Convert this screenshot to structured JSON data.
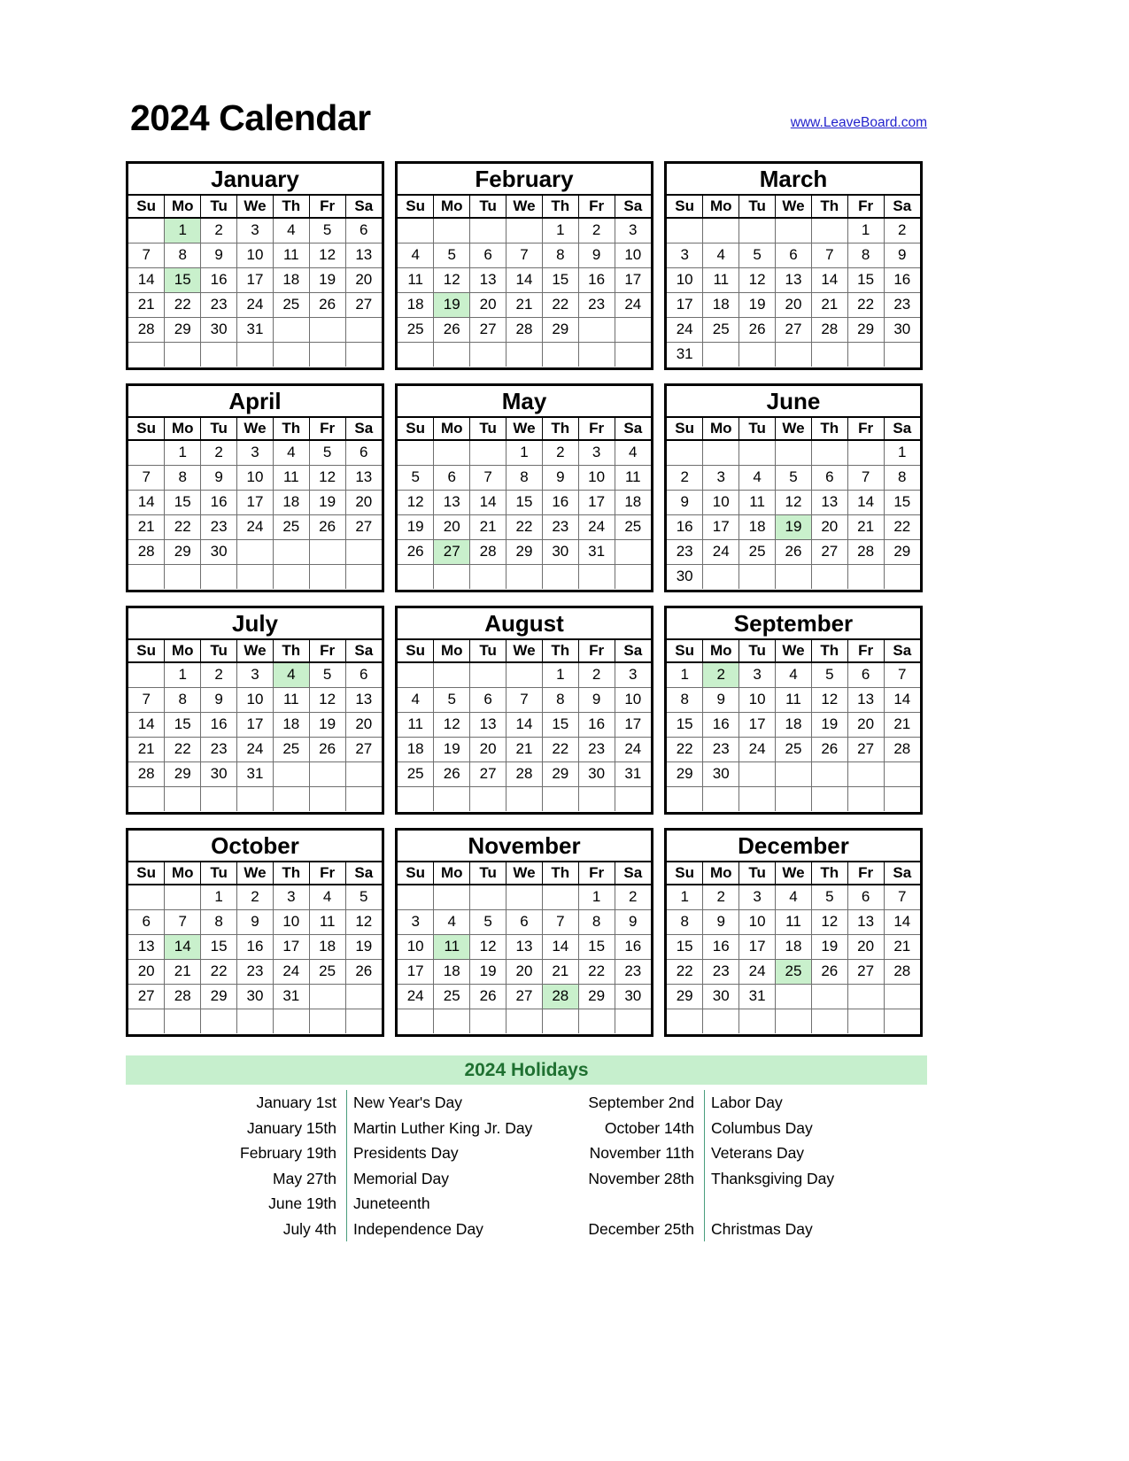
{
  "header": {
    "title": "2024 Calendar",
    "url": "www.LeaveBoard.com",
    "url_color": "#2222cc"
  },
  "weekdays": [
    "Su",
    "Mo",
    "Tu",
    "We",
    "Th",
    "Fr",
    "Sa"
  ],
  "highlight_color": "#c9f0cc",
  "months": [
    {
      "name": "January",
      "weeks": [
        [
          "",
          "1",
          "2",
          "3",
          "4",
          "5",
          "6"
        ],
        [
          "7",
          "8",
          "9",
          "10",
          "11",
          "12",
          "13"
        ],
        [
          "14",
          "15",
          "16",
          "17",
          "18",
          "19",
          "20"
        ],
        [
          "21",
          "22",
          "23",
          "24",
          "25",
          "26",
          "27"
        ],
        [
          "28",
          "29",
          "30",
          "31",
          "",
          "",
          ""
        ],
        [
          "",
          "",
          "",
          "",
          "",
          "",
          ""
        ]
      ],
      "highlights": [
        "1",
        "15"
      ]
    },
    {
      "name": "February",
      "weeks": [
        [
          "",
          "",
          "",
          "",
          "1",
          "2",
          "3"
        ],
        [
          "4",
          "5",
          "6",
          "7",
          "8",
          "9",
          "10"
        ],
        [
          "11",
          "12",
          "13",
          "14",
          "15",
          "16",
          "17"
        ],
        [
          "18",
          "19",
          "20",
          "21",
          "22",
          "23",
          "24"
        ],
        [
          "25",
          "26",
          "27",
          "28",
          "29",
          "",
          ""
        ],
        [
          "",
          "",
          "",
          "",
          "",
          "",
          ""
        ]
      ],
      "highlights": [
        "19"
      ]
    },
    {
      "name": "March",
      "weeks": [
        [
          "",
          "",
          "",
          "",
          "",
          "1",
          "2"
        ],
        [
          "3",
          "4",
          "5",
          "6",
          "7",
          "8",
          "9"
        ],
        [
          "10",
          "11",
          "12",
          "13",
          "14",
          "15",
          "16"
        ],
        [
          "17",
          "18",
          "19",
          "20",
          "21",
          "22",
          "23"
        ],
        [
          "24",
          "25",
          "26",
          "27",
          "28",
          "29",
          "30"
        ],
        [
          "31",
          "",
          "",
          "",
          "",
          "",
          ""
        ]
      ],
      "highlights": []
    },
    {
      "name": "April",
      "weeks": [
        [
          "",
          "1",
          "2",
          "3",
          "4",
          "5",
          "6"
        ],
        [
          "7",
          "8",
          "9",
          "10",
          "11",
          "12",
          "13"
        ],
        [
          "14",
          "15",
          "16",
          "17",
          "18",
          "19",
          "20"
        ],
        [
          "21",
          "22",
          "23",
          "24",
          "25",
          "26",
          "27"
        ],
        [
          "28",
          "29",
          "30",
          "",
          "",
          "",
          ""
        ],
        [
          "",
          "",
          "",
          "",
          "",
          "",
          ""
        ]
      ],
      "highlights": []
    },
    {
      "name": "May",
      "weeks": [
        [
          "",
          "",
          "",
          "1",
          "2",
          "3",
          "4"
        ],
        [
          "5",
          "6",
          "7",
          "8",
          "9",
          "10",
          "11"
        ],
        [
          "12",
          "13",
          "14",
          "15",
          "16",
          "17",
          "18"
        ],
        [
          "19",
          "20",
          "21",
          "22",
          "23",
          "24",
          "25"
        ],
        [
          "26",
          "27",
          "28",
          "29",
          "30",
          "31",
          ""
        ],
        [
          "",
          "",
          "",
          "",
          "",
          "",
          ""
        ]
      ],
      "highlights": [
        "27"
      ]
    },
    {
      "name": "June",
      "weeks": [
        [
          "",
          "",
          "",
          "",
          "",
          "",
          "1"
        ],
        [
          "2",
          "3",
          "4",
          "5",
          "6",
          "7",
          "8"
        ],
        [
          "9",
          "10",
          "11",
          "12",
          "13",
          "14",
          "15"
        ],
        [
          "16",
          "17",
          "18",
          "19",
          "20",
          "21",
          "22"
        ],
        [
          "23",
          "24",
          "25",
          "26",
          "27",
          "28",
          "29"
        ],
        [
          "30",
          "",
          "",
          "",
          "",
          "",
          ""
        ]
      ],
      "highlights": [
        "19"
      ]
    },
    {
      "name": "July",
      "weeks": [
        [
          "",
          "1",
          "2",
          "3",
          "4",
          "5",
          "6"
        ],
        [
          "7",
          "8",
          "9",
          "10",
          "11",
          "12",
          "13"
        ],
        [
          "14",
          "15",
          "16",
          "17",
          "18",
          "19",
          "20"
        ],
        [
          "21",
          "22",
          "23",
          "24",
          "25",
          "26",
          "27"
        ],
        [
          "28",
          "29",
          "30",
          "31",
          "",
          "",
          ""
        ],
        [
          "",
          "",
          "",
          "",
          "",
          "",
          ""
        ]
      ],
      "highlights": [
        "4"
      ]
    },
    {
      "name": "August",
      "weeks": [
        [
          "",
          "",
          "",
          "",
          "1",
          "2",
          "3"
        ],
        [
          "4",
          "5",
          "6",
          "7",
          "8",
          "9",
          "10"
        ],
        [
          "11",
          "12",
          "13",
          "14",
          "15",
          "16",
          "17"
        ],
        [
          "18",
          "19",
          "20",
          "21",
          "22",
          "23",
          "24"
        ],
        [
          "25",
          "26",
          "27",
          "28",
          "29",
          "30",
          "31"
        ],
        [
          "",
          "",
          "",
          "",
          "",
          "",
          ""
        ]
      ],
      "highlights": []
    },
    {
      "name": "September",
      "weeks": [
        [
          "1",
          "2",
          "3",
          "4",
          "5",
          "6",
          "7"
        ],
        [
          "8",
          "9",
          "10",
          "11",
          "12",
          "13",
          "14"
        ],
        [
          "15",
          "16",
          "17",
          "18",
          "19",
          "20",
          "21"
        ],
        [
          "22",
          "23",
          "24",
          "25",
          "26",
          "27",
          "28"
        ],
        [
          "29",
          "30",
          "",
          "",
          "",
          "",
          ""
        ],
        [
          "",
          "",
          "",
          "",
          "",
          "",
          ""
        ]
      ],
      "highlights": [
        "2"
      ]
    },
    {
      "name": "October",
      "weeks": [
        [
          "",
          "",
          "1",
          "2",
          "3",
          "4",
          "5"
        ],
        [
          "6",
          "7",
          "8",
          "9",
          "10",
          "11",
          "12"
        ],
        [
          "13",
          "14",
          "15",
          "16",
          "17",
          "18",
          "19"
        ],
        [
          "20",
          "21",
          "22",
          "23",
          "24",
          "25",
          "26"
        ],
        [
          "27",
          "28",
          "29",
          "30",
          "31",
          "",
          ""
        ],
        [
          "",
          "",
          "",
          "",
          "",
          "",
          ""
        ]
      ],
      "highlights": [
        "14"
      ]
    },
    {
      "name": "November",
      "weeks": [
        [
          "",
          "",
          "",
          "",
          "",
          "1",
          "2"
        ],
        [
          "3",
          "4",
          "5",
          "6",
          "7",
          "8",
          "9"
        ],
        [
          "10",
          "11",
          "12",
          "13",
          "14",
          "15",
          "16"
        ],
        [
          "17",
          "18",
          "19",
          "20",
          "21",
          "22",
          "23"
        ],
        [
          "24",
          "25",
          "26",
          "27",
          "28",
          "29",
          "30"
        ],
        [
          "",
          "",
          "",
          "",
          "",
          "",
          ""
        ]
      ],
      "highlights": [
        "11",
        "28"
      ]
    },
    {
      "name": "December",
      "weeks": [
        [
          "1",
          "2",
          "3",
          "4",
          "5",
          "6",
          "7"
        ],
        [
          "8",
          "9",
          "10",
          "11",
          "12",
          "13",
          "14"
        ],
        [
          "15",
          "16",
          "17",
          "18",
          "19",
          "20",
          "21"
        ],
        [
          "22",
          "23",
          "24",
          "25",
          "26",
          "27",
          "28"
        ],
        [
          "29",
          "30",
          "31",
          "",
          "",
          "",
          ""
        ],
        [
          "",
          "",
          "",
          "",
          "",
          "",
          ""
        ]
      ],
      "highlights": [
        "25"
      ]
    }
  ],
  "holidays_section": {
    "heading": "2024 Holidays",
    "heading_color": "#1f7031",
    "band_color": "#c6efcd",
    "left_column": [
      {
        "date": "January 1st",
        "name": "New Year's Day"
      },
      {
        "date": "January 15th",
        "name": "Martin Luther King Jr. Day"
      },
      {
        "date": "February 19th",
        "name": "Presidents Day"
      },
      {
        "date": "May 27th",
        "name": "Memorial Day"
      },
      {
        "date": "June 19th",
        "name": "Juneteenth"
      },
      {
        "date": "July 4th",
        "name": "Independence Day"
      }
    ],
    "right_column": [
      {
        "date": "September 2nd",
        "name": "Labor Day"
      },
      {
        "date": "October 14th",
        "name": "Columbus Day"
      },
      {
        "date": "November 11th",
        "name": "Veterans Day"
      },
      {
        "date": "November 28th",
        "name": "Thanksgiving Day"
      },
      {
        "date": "",
        "name": ""
      },
      {
        "date": "December 25th",
        "name": "Christmas Day"
      }
    ]
  }
}
